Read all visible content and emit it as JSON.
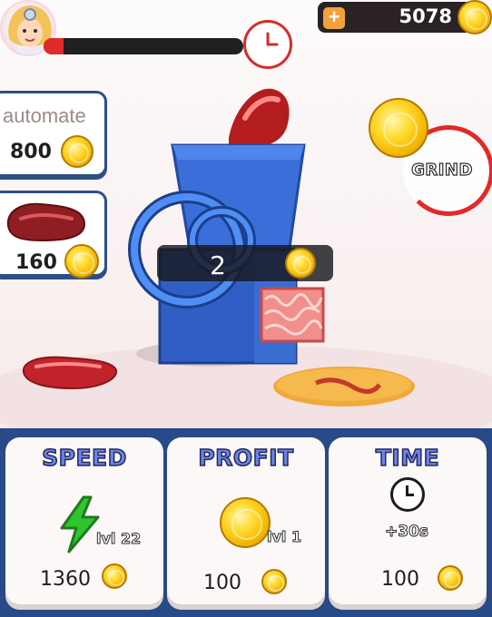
{
  "hud": {
    "coins": "5078",
    "plus_label": "+",
    "timer_progress": 0.1,
    "icons": [
      "avatar",
      "clock-icon",
      "plus-icon",
      "coin-icon"
    ]
  },
  "side": {
    "automate": {
      "label": "automate",
      "price": "800"
    },
    "meat": {
      "price": "160"
    }
  },
  "grinder": {
    "counter": "2",
    "grind_label": "GRIND"
  },
  "upgrades": [
    {
      "title": "SPEED",
      "level": "lvl 22",
      "cost": "1360",
      "icon": "lightning-icon"
    },
    {
      "title": "PROFIT",
      "level": "lvl 1",
      "cost": "100",
      "icon": "coin-icon"
    },
    {
      "title": "TIME",
      "level": "+30s",
      "cost": "100",
      "icon": "clock-icon"
    }
  ],
  "colors": {
    "accent_blue": "#284a86",
    "timer_red": "#e02a2a",
    "coin_gold": "#ffd92e",
    "title_blue": "#6f82e8",
    "lightning_green": "#2fc52f"
  }
}
